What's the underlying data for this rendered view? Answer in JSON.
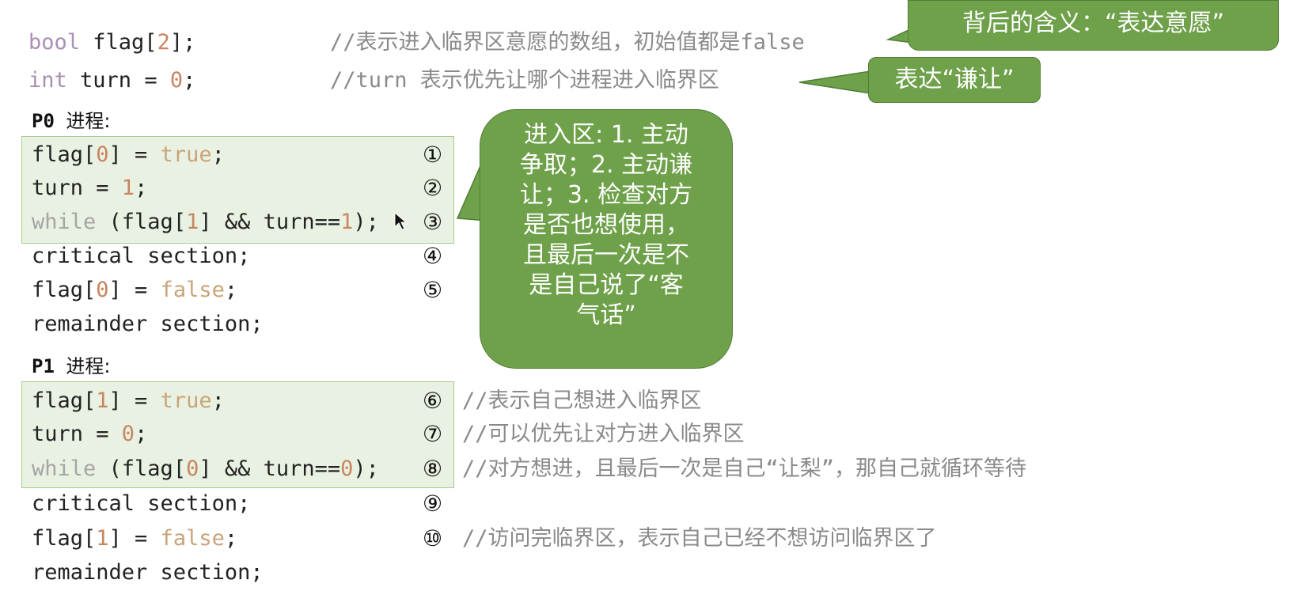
{
  "header": {
    "line1_code": "bool flag[2];",
    "line1_comment": "//表示进入临界区意愿的数组，初始值都是false",
    "line2_code": "int turn = 0;",
    "line2_comment": "//turn 表示优先让哪个进程进入临界区"
  },
  "p0": {
    "title": "P0 进程:",
    "lines": [
      {
        "code": "flag[0] = true;",
        "mark": "①"
      },
      {
        "code": "turn = 1;",
        "mark": "②"
      },
      {
        "code": "while (flag[1] && turn==1);",
        "mark": "③"
      },
      {
        "code": "critical section;",
        "mark": "④"
      },
      {
        "code": "flag[0] = false;",
        "mark": "⑤"
      },
      {
        "code": "remainder section;",
        "mark": ""
      }
    ]
  },
  "p1": {
    "title": "P1 进程:",
    "lines": [
      {
        "code": "flag[1] = true;",
        "mark": "⑥",
        "comment": "//表示自己想进入临界区"
      },
      {
        "code": "turn = 0;",
        "mark": "⑦",
        "comment": "//可以优先让对方进入临界区"
      },
      {
        "code": "while (flag[0] && turn==0);",
        "mark": "⑧",
        "comment": "//对方想进，且最后一次是自己“让梨”，那自己就循环等待"
      },
      {
        "code": "critical section;",
        "mark": "⑨",
        "comment": ""
      },
      {
        "code": "flag[1] = false;",
        "mark": "⑩",
        "comment": "//访问完临界区，表示自己已经不想访问临界区了"
      },
      {
        "code": "remainder section;",
        "mark": "",
        "comment": ""
      }
    ]
  },
  "callouts": {
    "meaning": "背后的含义：“表达意愿”",
    "yield": "表达“谦让”",
    "entry": [
      "进入区: 1. 主动",
      "争取；2. 主动谦",
      "让；3. 检查对方",
      "是否也想使用，",
      "且最后一次是不",
      "是自己说了“客",
      "气话”"
    ]
  },
  "colors": {
    "callout_fill": "#6ea14a",
    "box_fill": "#e9f2e2",
    "keyword": "#a98fb5",
    "number": "#c88560"
  }
}
